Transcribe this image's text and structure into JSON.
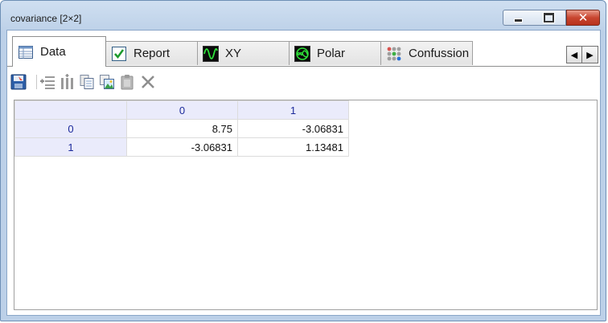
{
  "window": {
    "title": "covariance [2×2]",
    "controls": {
      "minimize": "minimize",
      "maximize": "maximize",
      "close": "✕"
    }
  },
  "tabs": [
    {
      "label": "Data",
      "icon": "table-icon",
      "active": true
    },
    {
      "label": "Report",
      "icon": "checkmark-icon",
      "active": false
    },
    {
      "label": "XY",
      "icon": "sine-wave-icon",
      "active": false
    },
    {
      "label": "Polar",
      "icon": "polar-plot-icon",
      "active": false
    },
    {
      "label": "Confussion",
      "icon": "colored-dots-icon",
      "active": false
    }
  ],
  "tab_scroll": {
    "left": "◀",
    "right": "▶"
  },
  "toolbar": {
    "tools": [
      "save-icon",
      "add-rows-icon",
      "columns-icon",
      "copy-icon",
      "paste-image-icon",
      "clipboard-icon",
      "delete-icon"
    ]
  },
  "grid": {
    "columns": [
      "0",
      "1"
    ],
    "rows": [
      {
        "header": "0",
        "cells": [
          "8.75",
          "-3.06831"
        ]
      },
      {
        "header": "1",
        "cells": [
          "-3.06831",
          "1.13481"
        ]
      }
    ]
  },
  "colors": {
    "header_bg": "#eaebfb",
    "header_text": "#1c2a9b",
    "window_frame": "#bcd0e8",
    "close_button": "#c8452f"
  }
}
